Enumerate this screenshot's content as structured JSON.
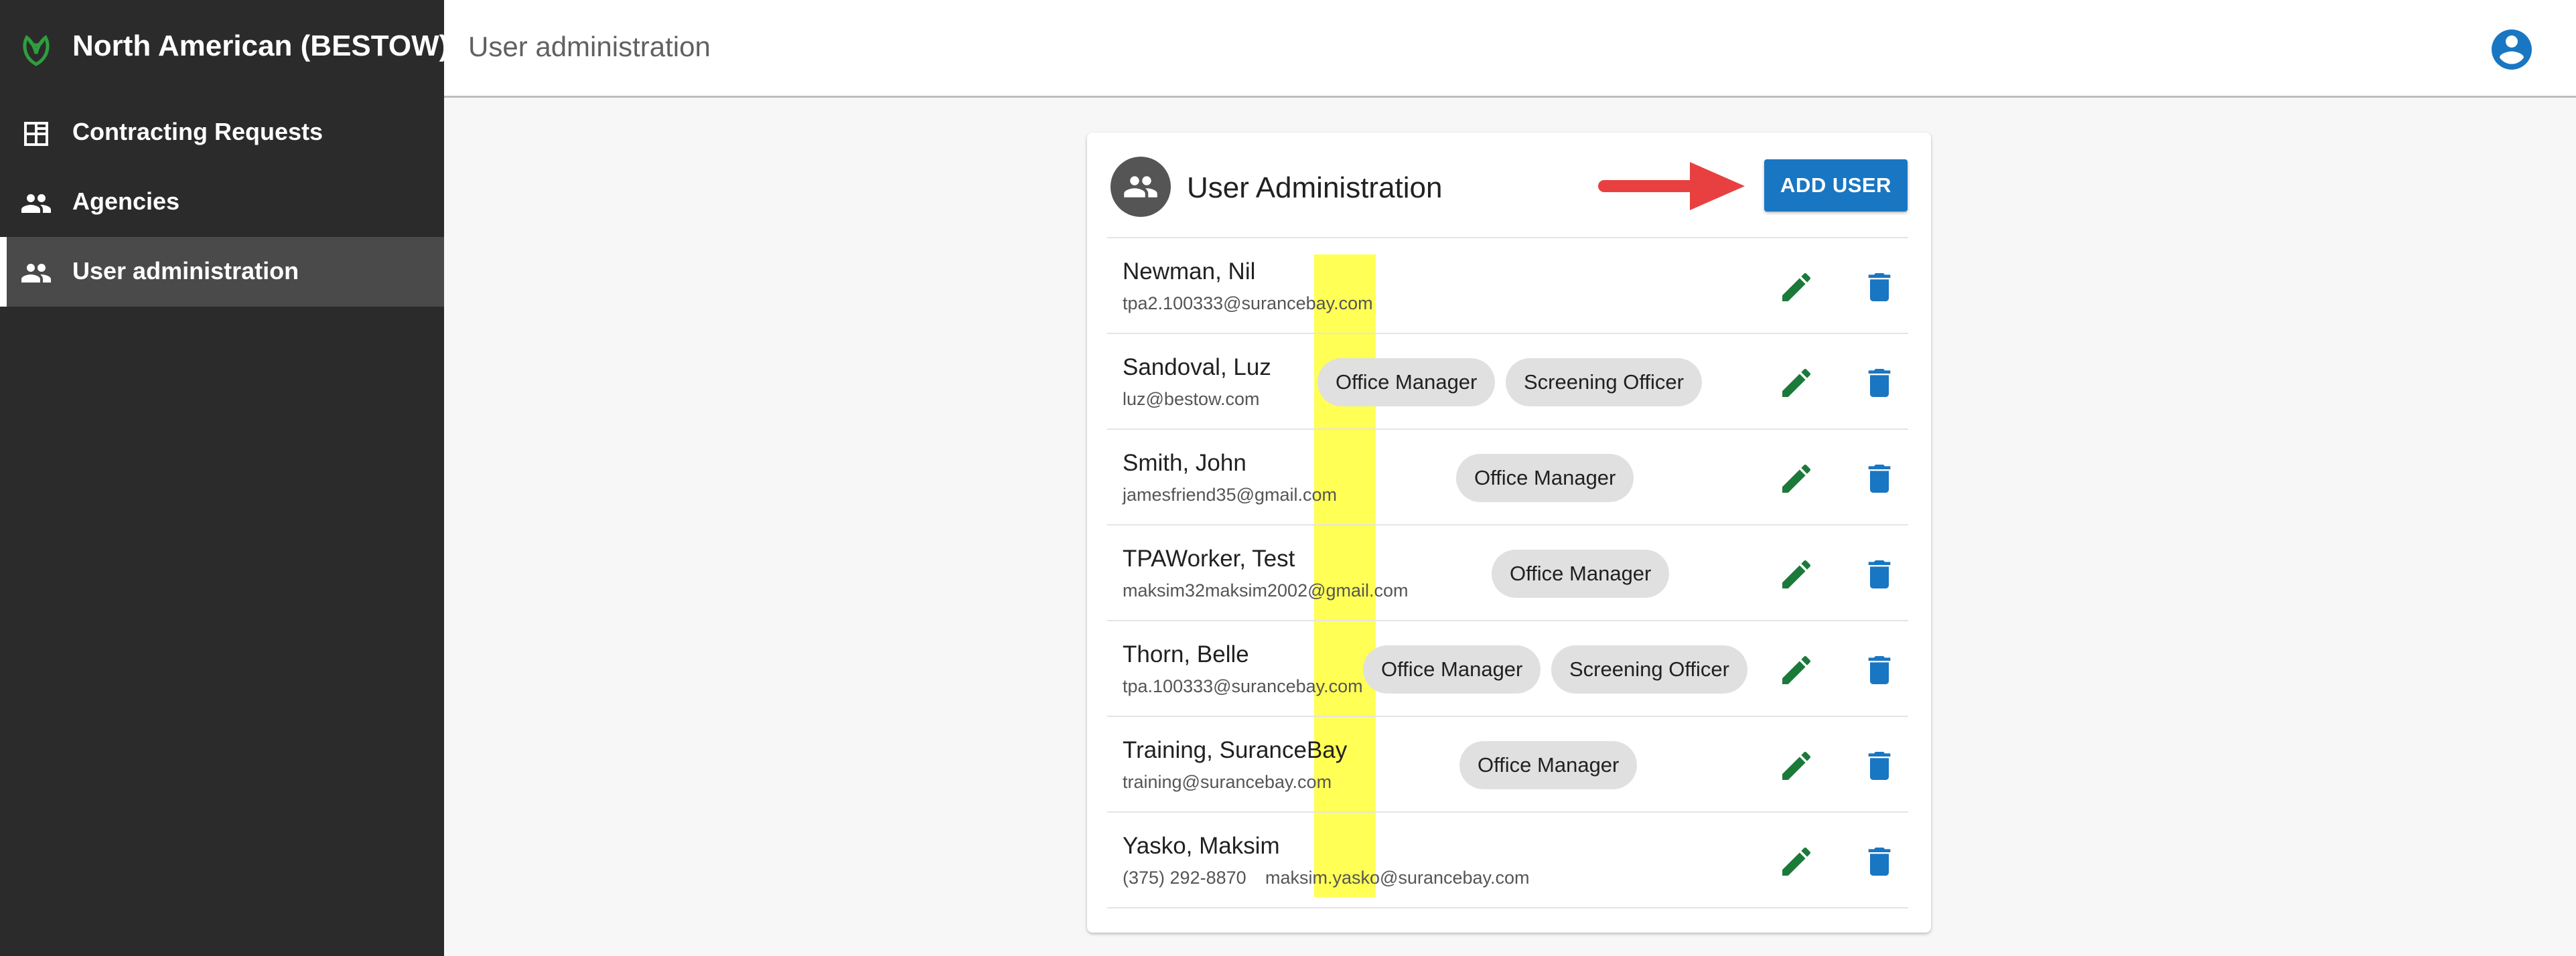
{
  "brand": {
    "title": "North American (BESTOW)",
    "logo_color": "#2e9e3e"
  },
  "sidebar": {
    "items": [
      {
        "label": "Contracting Requests",
        "icon": "dashboard-icon"
      },
      {
        "label": "Agencies",
        "icon": "people-icon"
      },
      {
        "label": "User administration",
        "icon": "people-icon",
        "active": true
      }
    ]
  },
  "header": {
    "title": "User administration",
    "account_icon": "account-circle-icon"
  },
  "card": {
    "title": "User Administration",
    "add_button": "ADD USER",
    "accent_color": "#1976c2",
    "arrow_color": "#e84040"
  },
  "users": [
    {
      "name": "Newman, Nil",
      "email": "tpa2.100333@surancebay.com",
      "roles": []
    },
    {
      "name": "Sandoval, Luz",
      "email": "luz@bestow.com",
      "roles": [
        "Office Manager",
        "Screening Officer"
      ]
    },
    {
      "name": "Smith, John",
      "email": "jamesfriend35@gmail.com",
      "roles": [
        "Office Manager"
      ]
    },
    {
      "name": "TPAWorker, Test",
      "email": "maksim32maksim2002@gmail.com",
      "roles": [
        "Office Manager"
      ]
    },
    {
      "name": "Thorn, Belle",
      "email": "tpa.100333@surancebay.com",
      "roles": [
        "Office Manager",
        "Screening Officer"
      ]
    },
    {
      "name": "Training, SuranceBay",
      "email": "training@surancebay.com",
      "roles": [
        "Office Manager"
      ]
    },
    {
      "name": "Yasko, Maksim",
      "phone": "(375) 292-8870",
      "email": "maksim.yasko@surancebay.com",
      "roles": []
    }
  ],
  "colors": {
    "edit": "#1b7a3a",
    "delete": "#1976c2",
    "highlight": "#ffff55"
  }
}
